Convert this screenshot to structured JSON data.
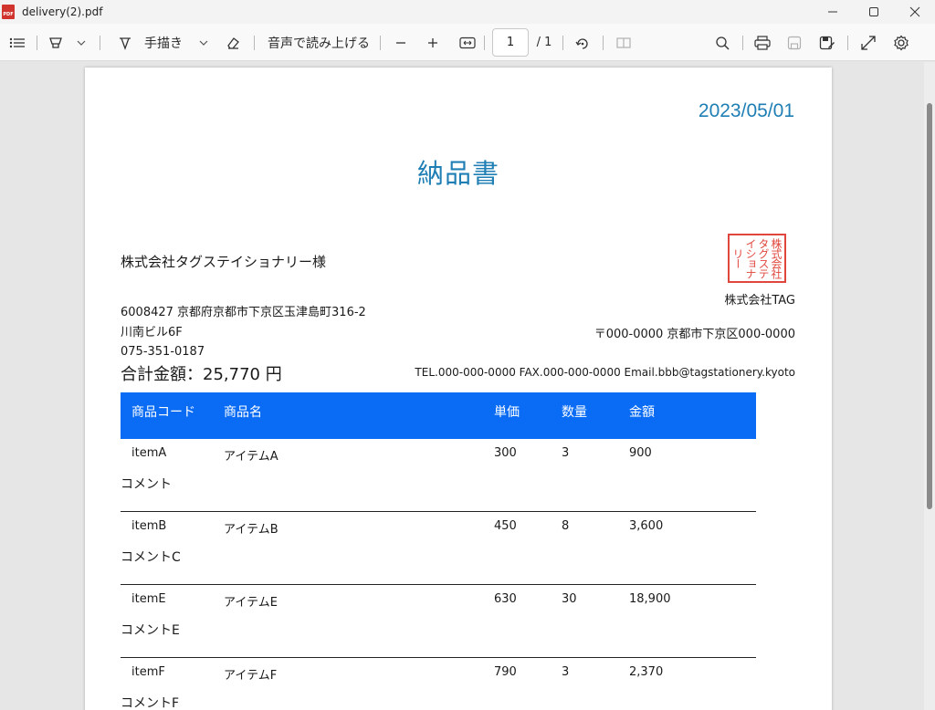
{
  "window": {
    "title": "delivery(2).pdf",
    "pdf_badge": "PDF"
  },
  "toolbar": {
    "draw_label": "手描き",
    "read_aloud_label": "音声で読み上げる",
    "page_current": "1",
    "page_total": "/ 1"
  },
  "document": {
    "date": "2023/05/01",
    "title": "納品書",
    "customer": "株式会社タグステイショナリー様",
    "address_lines": [
      "6008427 京都府京都市下京区玉津島町316-2",
      "川南ビル6F",
      "075-351-0187"
    ],
    "total": "合計金額：25,770 円",
    "company": "株式会社TAG",
    "company_address": "〒000-0000 京都市下京区000-0000",
    "contact": "TEL.000-000-0000 FAX.000-000-0000 Email.bbb@tagstationery.kyoto",
    "stamp_text": [
      "株式会社",
      "タグステ",
      "イショナ",
      "リー"
    ],
    "table": {
      "header_color": "#0a6cf5",
      "headers": [
        "商品コード",
        "商品名",
        "単価",
        "数量",
        "金額"
      ],
      "rows": [
        {
          "code": "itemA",
          "name": "アイテムA",
          "price": "300",
          "qty": "3",
          "amount": "900",
          "comment": "コメント"
        },
        {
          "code": "itemB",
          "name": "アイテムB",
          "price": "450",
          "qty": "8",
          "amount": "3,600",
          "comment": "コメントC"
        },
        {
          "code": "itemE",
          "name": "アイテムE",
          "price": "630",
          "qty": "30",
          "amount": "18,900",
          "comment": "コメントE"
        },
        {
          "code": "itemF",
          "name": "アイテムF",
          "price": "790",
          "qty": "3",
          "amount": "2,370",
          "comment": "コメントF"
        }
      ]
    }
  }
}
